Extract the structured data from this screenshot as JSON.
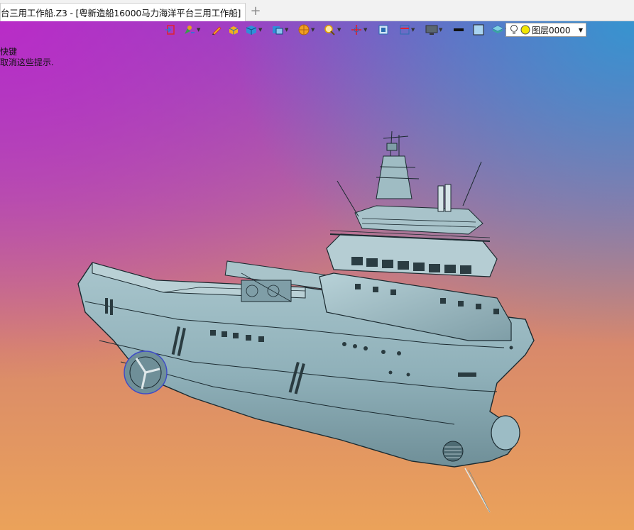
{
  "tab": {
    "title": "台三用工作船.Z3 - [粤新造船16000马力海洋平台三用工作船]",
    "close_glyph": "✕",
    "add_glyph": "+"
  },
  "hint": {
    "line1": "快键",
    "line2": "取消这些提示."
  },
  "toolbar": {
    "icons": [
      "exit-sketch-icon",
      "pen-tool-icon",
      "pencil-icon",
      "box-solid-icon",
      "cube-icon",
      "view-cube-icon",
      "render-sphere-icon",
      "zoom-icon",
      "pan-icon",
      "frame-icon",
      "grid-view-icon",
      "display-icon",
      "line-style-icon",
      "color-swatch-icon",
      "layer-stack-icon"
    ],
    "layer": {
      "value": "图层0000"
    }
  },
  "colors": {
    "hull": "#8fb3bd",
    "hull_dark": "#4e6b73",
    "edge": "#1b2a30"
  }
}
